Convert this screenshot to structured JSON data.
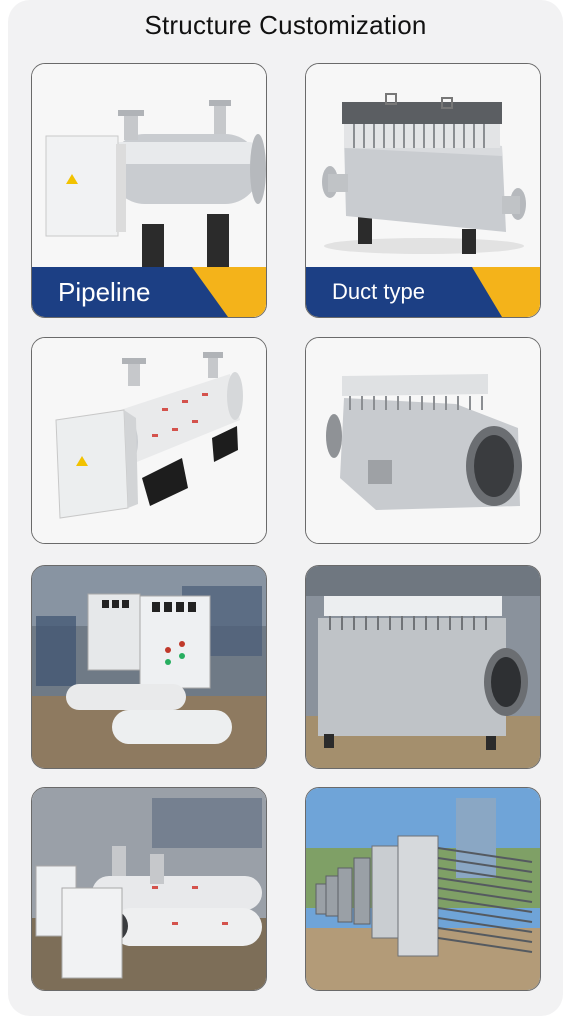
{
  "page": {
    "title": "Structure Customization",
    "colors": {
      "panel": "#f2f2f3",
      "banner_blue": "#1c3f84",
      "banner_yellow": "#f4b31a",
      "card_border": "#6a6a6a"
    }
  },
  "cards": [
    {
      "name": "card-pipeline-heater",
      "label": "Pipeline"
    },
    {
      "name": "card-duct-heater",
      "label": "Duct type"
    },
    {
      "name": "card-pipeline-heater-2"
    },
    {
      "name": "card-duct-heater-2"
    },
    {
      "name": "card-pipeline-photo"
    },
    {
      "name": "card-duct-photo"
    },
    {
      "name": "card-pipeline-photo-2"
    },
    {
      "name": "card-duct-photo-2"
    }
  ]
}
